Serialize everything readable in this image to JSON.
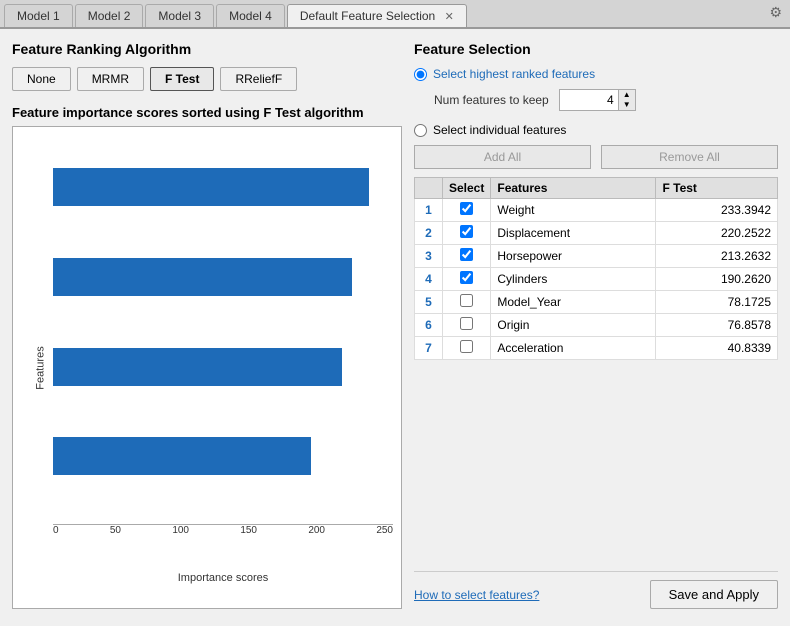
{
  "tabs": [
    {
      "label": "Model 1",
      "active": false,
      "closable": false
    },
    {
      "label": "Model 2",
      "active": false,
      "closable": false
    },
    {
      "label": "Model 3",
      "active": false,
      "closable": false
    },
    {
      "label": "Model 4",
      "active": false,
      "closable": false
    },
    {
      "label": "Default Feature Selection",
      "active": true,
      "closable": true
    }
  ],
  "left_panel": {
    "title": "Feature Ranking Algorithm",
    "buttons": [
      {
        "label": "None",
        "selected": false
      },
      {
        "label": "MRMR",
        "selected": false
      },
      {
        "label": "F Test",
        "selected": true
      },
      {
        "label": "RReliefF",
        "selected": false
      }
    ],
    "chart_title": "Feature importance scores sorted using F Test algorithm",
    "chart": {
      "bars": [
        {
          "value": 233.3942,
          "width_pct": 93
        },
        {
          "value": 220.2522,
          "width_pct": 88
        },
        {
          "value": 213.2632,
          "width_pct": 85
        },
        {
          "value": 190.262,
          "width_pct": 76
        }
      ],
      "x_ticks": [
        "0",
        "50",
        "100",
        "150",
        "200",
        "250"
      ],
      "x_label": "Importance scores",
      "y_label": "Features"
    }
  },
  "right_panel": {
    "title": "Feature Selection",
    "radio_highest": "Select highest ranked features",
    "num_features_label": "Num features to keep",
    "num_features_value": "4",
    "radio_individual": "Select individual features",
    "add_all_label": "Add All",
    "remove_all_label": "Remove All",
    "table_headers": [
      "",
      "Select",
      "Features",
      "F Test"
    ],
    "features": [
      {
        "num": "1",
        "checked": true,
        "name": "Weight",
        "score": "233.3942"
      },
      {
        "num": "2",
        "checked": true,
        "name": "Displacement",
        "score": "220.2522"
      },
      {
        "num": "3",
        "checked": true,
        "name": "Horsepower",
        "score": "213.2632"
      },
      {
        "num": "4",
        "checked": true,
        "name": "Cylinders",
        "score": "190.2620"
      },
      {
        "num": "5",
        "checked": false,
        "name": "Model_Year",
        "score": "78.1725"
      },
      {
        "num": "6",
        "checked": false,
        "name": "Origin",
        "score": "76.8578"
      },
      {
        "num": "7",
        "checked": false,
        "name": "Acceleration",
        "score": "40.8339"
      }
    ],
    "help_link": "How to select features?",
    "save_apply_label": "Save and Apply"
  }
}
